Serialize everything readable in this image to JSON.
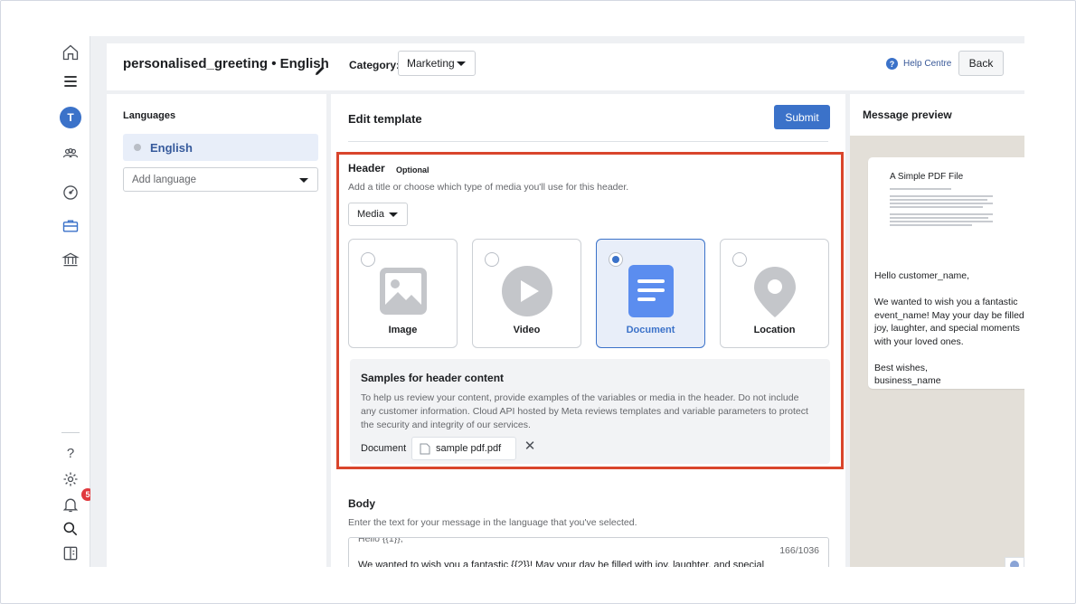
{
  "topbar": {
    "template_name": "personalised_greeting • English",
    "category_label": "Category:",
    "category_value": "Marketing",
    "help_label": "Help Centre",
    "back_label": "Back"
  },
  "sidebar": {
    "avatar_initial": "T",
    "icons": [
      "home-icon",
      "menu-icon",
      "people-icon",
      "dashboard-icon",
      "briefcase-icon",
      "bank-icon",
      "help-icon",
      "gear-icon",
      "bell-icon",
      "search-icon",
      "panel-icon"
    ],
    "notification_count": "5",
    "help_glyph": "?"
  },
  "languages": {
    "title": "Languages",
    "items": [
      {
        "label": "English"
      }
    ],
    "add_placeholder": "Add language"
  },
  "editor": {
    "title": "Edit template",
    "submit_label": "Submit",
    "header": {
      "title": "Header",
      "optional": "Optional",
      "subtitle": "Add a title or choose which type of media you'll use for this header.",
      "type_value": "Media",
      "media_options": [
        {
          "label": "Image",
          "selected": false
        },
        {
          "label": "Video",
          "selected": false
        },
        {
          "label": "Document",
          "selected": true
        },
        {
          "label": "Location",
          "selected": false
        }
      ]
    },
    "samples": {
      "title": "Samples for header content",
      "description": "To help us review your content, provide examples of the variables or media in the header. Do not include any customer information. Cloud API hosted by Meta reviews templates and variable parameters to protect the security and integrity of our services.",
      "document_label": "Document",
      "file_name": "sample pdf.pdf",
      "remove_glyph": "✕"
    },
    "body": {
      "title": "Body",
      "subtitle": "Enter the text for your message in the language that you've selected.",
      "cut_line": "Hello {{1}},",
      "char_count": "166/1036",
      "text": "We wanted to wish you a fantastic {{2}}! May your day be filled with joy, laughter, and special"
    }
  },
  "preview": {
    "title": "Message preview",
    "pdf_title": "A Simple PDF File",
    "lines": [
      "Hello customer_name,",
      "We wanted to wish you a fantastic",
      "event_name! May your day be filled",
      "joy, laughter, and special moments",
      "with your loved ones.",
      "Best wishes,",
      "business_name"
    ]
  },
  "colors": {
    "accent": "#3b72c9",
    "highlight_border": "#d9452c",
    "badge": "#e0393e"
  }
}
